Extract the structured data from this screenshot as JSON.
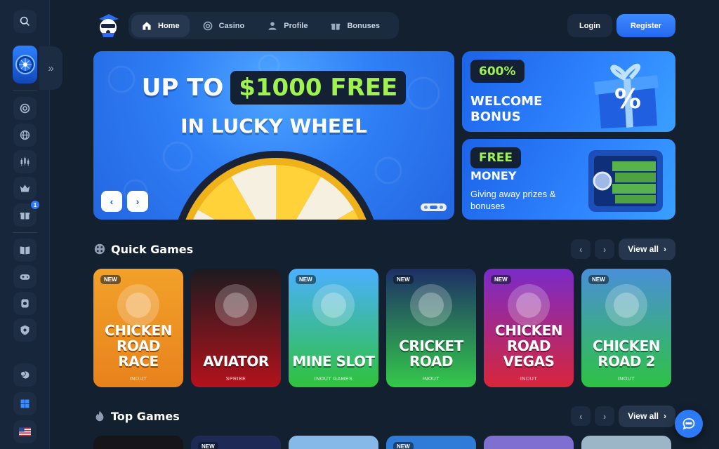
{
  "nav": {
    "items": [
      {
        "label": "Home",
        "icon": "home-icon",
        "active": true
      },
      {
        "label": "Casino",
        "icon": "casino-chip-icon",
        "active": false
      },
      {
        "label": "Profile",
        "icon": "user-icon",
        "active": false
      },
      {
        "label": "Bonuses",
        "icon": "gift-icon",
        "active": false
      }
    ],
    "login_label": "Login",
    "register_label": "Register"
  },
  "hero": {
    "line1_prefix": "UP TO",
    "line1_amount": "$1000 FREE",
    "line2": "IN LUCKY WHEEL"
  },
  "promos": [
    {
      "pill": "600%",
      "title": "WELCOME BONUS"
    },
    {
      "pill": "FREE",
      "title": "MONEY",
      "subtitle": "Giving away prizes & bonuses"
    }
  ],
  "quick_games": {
    "title": "Quick Games",
    "view_all": "View all",
    "items": [
      {
        "name": "CHICKEN ROAD RACE",
        "provider": "INOUT",
        "new": true,
        "badge": "NEW",
        "color_top": "#f2a12a",
        "color_bottom": "#e8821c"
      },
      {
        "name": "AVIATOR",
        "provider": "SPRIBE",
        "new": false,
        "badge": "",
        "color_top": "#1b1b1f",
        "color_bottom": "#b3121c"
      },
      {
        "name": "MINE SLOT",
        "provider": "INOUT GAMES",
        "new": true,
        "badge": "NEW",
        "color_top": "#4ab0ff",
        "color_bottom": "#2fc23c"
      },
      {
        "name": "CRICKET ROAD",
        "provider": "INOUT",
        "new": true,
        "badge": "NEW",
        "color_top": "#1d2f66",
        "color_bottom": "#34c94a"
      },
      {
        "name": "CHICKEN ROAD VEGAS",
        "provider": "INOUT",
        "new": true,
        "badge": "NEW",
        "color_top": "#7a2bc9",
        "color_bottom": "#d8263a"
      },
      {
        "name": "CHICKEN ROAD 2",
        "provider": "INOUT",
        "new": true,
        "badge": "NEW",
        "color_top": "#4a8fd8",
        "color_bottom": "#2ec244"
      }
    ]
  },
  "top_games": {
    "title": "Top Games",
    "view_all": "View all",
    "items": [
      {
        "badge": "",
        "color": "#15151a"
      },
      {
        "badge": "NEW",
        "color": "#1e2a55"
      },
      {
        "badge": "",
        "color": "#86b9e8"
      },
      {
        "badge": "NEW",
        "color": "#2f7bd8"
      },
      {
        "badge": "",
        "color": "#7f6fd0"
      },
      {
        "badge": "",
        "color": "#9cb6c8"
      }
    ]
  }
}
